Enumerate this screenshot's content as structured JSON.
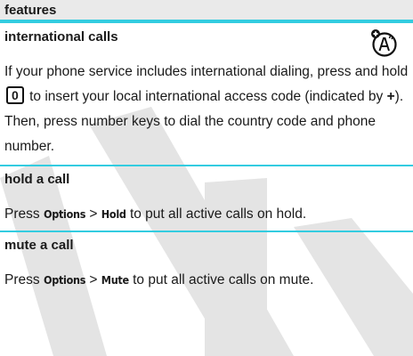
{
  "header": {
    "title": "features"
  },
  "sections": [
    {
      "title": "international calls",
      "icon": "network-feature-icon",
      "text_1": "If your phone service includes international dialing, press and hold",
      "key": "0",
      "text_2": "to insert your local international access code (indicated by",
      "plus": "+",
      "text_3": "). Then, press number keys to dial the country code and phone number."
    },
    {
      "title": "hold a call",
      "text_1": "Press",
      "menu_1": "Options",
      "separator": ">",
      "menu_2": "Hold",
      "text_2": "to put all active calls on hold."
    },
    {
      "title": "mute a call",
      "text_1": "Press",
      "menu_1": "Options",
      "separator": ">",
      "menu_2": "Mute",
      "text_2": "to put all active calls on mute."
    }
  ],
  "colors": {
    "accent": "#33cce0",
    "header_bg": "#eaeaea",
    "watermark": "#d9d9d9"
  }
}
